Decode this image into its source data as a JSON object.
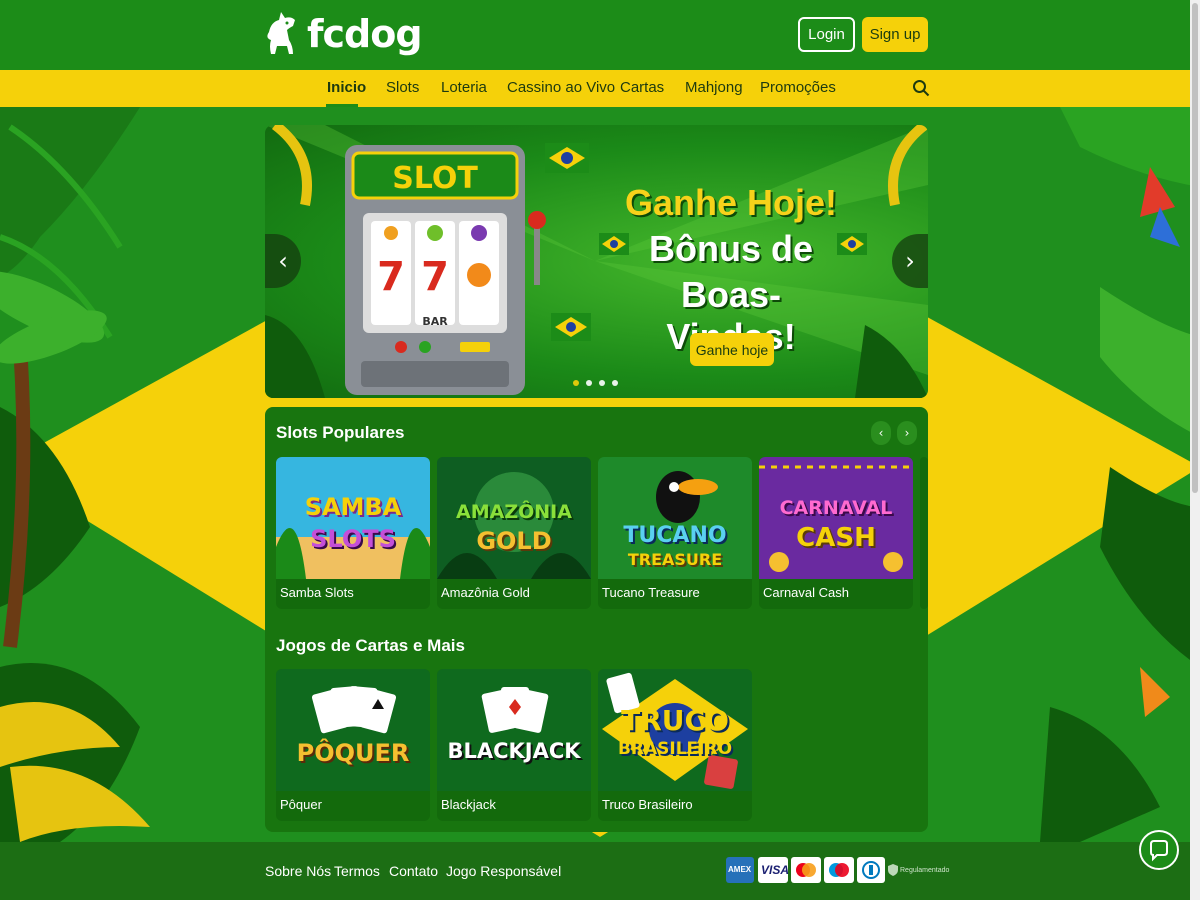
{
  "brand": {
    "name": "fcdog"
  },
  "auth": {
    "login_label": "Login",
    "signup_label": "Sign up"
  },
  "nav": {
    "items": [
      {
        "label": "Inicio",
        "active": true
      },
      {
        "label": "Slots"
      },
      {
        "label": "Loteria"
      },
      {
        "label": "Cassino ao Vivo"
      },
      {
        "label": "Cartas"
      },
      {
        "label": "Mahjong"
      },
      {
        "label": "Promoções"
      }
    ],
    "search_icon": "search-icon"
  },
  "banner": {
    "slot_sign": "SLOT",
    "reel_symbols": [
      "7",
      "7",
      "BAR"
    ],
    "line1": "Ganhe Hoje!",
    "line2": "Bônus de",
    "line3": "Boas-Vindas!",
    "cta_label": "Ganhe hoje",
    "slides": 4,
    "active_slide": 1
  },
  "sections": {
    "popular": {
      "title": "Slots Populares",
      "games": [
        {
          "thumb_line1": "SAMBA",
          "thumb_line2": "SLOTS",
          "label": "Samba Slots"
        },
        {
          "thumb_line1": "AMAZÔNIA",
          "thumb_line2": "GOLD",
          "label": "Amazônia Gold"
        },
        {
          "thumb_line1": "TUCANO",
          "thumb_line2": "TREASURE",
          "label": "Tucano Treasure"
        },
        {
          "thumb_line1": "CARNAVAL",
          "thumb_line2": "CASH",
          "label": "Carnaval Cash"
        }
      ]
    },
    "cards": {
      "title": "Jogos de Cartas e Mais",
      "games": [
        {
          "thumb_line1": "PÔQUER",
          "label": "Pôquer"
        },
        {
          "thumb_line1": "BLACKJACK",
          "label": "Blackjack"
        },
        {
          "thumb_line1": "TRUCO",
          "thumb_line2": "BRASILEIRO",
          "label": "Truco Brasileiro"
        }
      ]
    }
  },
  "footer": {
    "links": [
      "Sobre Nós",
      "Termos",
      "Contato",
      "Jogo Responsável"
    ],
    "payments": [
      "amex-icon",
      "visa-icon",
      "mastercard-icon",
      "maestro-icon",
      "diners-icon"
    ],
    "visa_text": "VISA",
    "amex_text": "AMEX",
    "regulated_text": "Regulamentado"
  },
  "colors": {
    "brand_green": "#1c8c18",
    "brand_yellow": "#f5d10a",
    "panel_green": "#18750f"
  }
}
